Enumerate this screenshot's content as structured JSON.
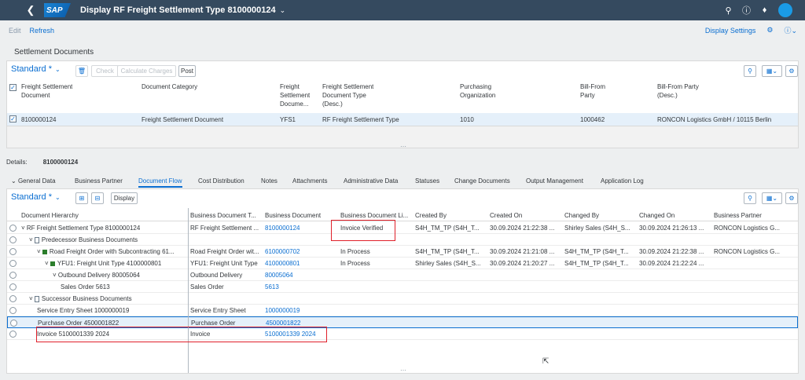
{
  "shell": {
    "title": "Display RF Freight Settlement Type 8100000124",
    "logo": "SAP"
  },
  "toolbar": {
    "edit": "Edit",
    "refresh": "Refresh",
    "display_settings": "Display Settings"
  },
  "section_title": "Settlement Documents",
  "settlement": {
    "view": "Standard *",
    "buttons": {
      "check": "Check",
      "calc": "Calculate Charges",
      "post": "Post"
    },
    "columns": [
      [
        "Freight Settlement",
        "Document"
      ],
      [
        "Document Category"
      ],
      [
        "Freight",
        "Settlement",
        "Docume..."
      ],
      [
        "Freight Settlement",
        "Document Type",
        "(Desc.)"
      ],
      [
        "Purchasing",
        "Organization"
      ],
      [
        "Bill-From",
        "Party"
      ],
      [
        "Bill-From Party",
        "(Desc.)"
      ]
    ],
    "row": [
      "8100000124",
      "Freight Settlement Document",
      "YFS1",
      "RF Freight Settlement Type",
      "1010",
      "1000462",
      "RONCON Logistics GmbH / 10115 Berlin"
    ]
  },
  "details": {
    "label": "Details:",
    "value": "8100000124"
  },
  "tabs": [
    "General Data",
    "Business Partner",
    "Document Flow",
    "Cost Distribution",
    "Notes",
    "Attachments",
    "Administrative Data",
    "Statuses",
    "Change Documents",
    "Output Management",
    "Application Log"
  ],
  "flow": {
    "view": "Standard *",
    "display_btn": "Display",
    "columns": [
      "Document Hierarchy",
      "Business Document T...",
      "Business Document",
      "Business Document Li...",
      "Created By",
      "Created On",
      "Changed By",
      "Changed On",
      "Business Partner"
    ],
    "rows": [
      {
        "h": "RF Freight Settlement Type 8100000124",
        "t": "RF Freight Settlement ...",
        "d": "8100000124",
        "l": "Invoice Verified",
        "cb": "S4H_TM_TP (S4H_T...",
        "co": "30.09.2024 21:22:38 ...",
        "chb": "Shirley Sales (S4H_S...",
        "cho": "30.09.2024 21:26:13 ...",
        "bp": "RONCON Logistics G..."
      },
      {
        "h": "Predecessor Business Documents",
        "t": "",
        "d": "",
        "l": "",
        "cb": "",
        "co": "",
        "chb": "",
        "cho": "",
        "bp": ""
      },
      {
        "h": "Road Freight Order with Subcontracting 61...",
        "t": "Road Freight Order wit...",
        "d": "6100000702",
        "l": "In Process",
        "cb": "S4H_TM_TP (S4H_T...",
        "co": "30.09.2024 21:21:08 ...",
        "chb": "S4H_TM_TP (S4H_T...",
        "cho": "30.09.2024 21:22:38 ...",
        "bp": "RONCON Logistics G..."
      },
      {
        "h": "YFU1: Freight Unit Type 4100000801",
        "t": "YFU1: Freight Unit Type",
        "d": "4100000801",
        "l": "In Process",
        "cb": "Shirley Sales (S4H_S...",
        "co": "30.09.2024 21:20:27 ...",
        "chb": "S4H_TM_TP (S4H_T...",
        "cho": "30.09.2024 21:22:24 ...",
        "bp": ""
      },
      {
        "h": "Outbound Delivery 80005064",
        "t": "Outbound Delivery",
        "d": "80005064",
        "l": "",
        "cb": "",
        "co": "",
        "chb": "",
        "cho": "",
        "bp": ""
      },
      {
        "h": "Sales Order 5613",
        "t": "Sales Order",
        "d": "5613",
        "l": "",
        "cb": "",
        "co": "",
        "chb": "",
        "cho": "",
        "bp": ""
      },
      {
        "h": "Successor Business Documents",
        "t": "",
        "d": "",
        "l": "",
        "cb": "",
        "co": "",
        "chb": "",
        "cho": "",
        "bp": ""
      },
      {
        "h": "Service Entry Sheet 1000000019",
        "t": "Service Entry Sheet",
        "d": "1000000019",
        "l": "",
        "cb": "",
        "co": "",
        "chb": "",
        "cho": "",
        "bp": ""
      },
      {
        "h": "Purchase Order 4500001822",
        "t": "Purchase Order",
        "d": "4500001822",
        "l": "",
        "cb": "",
        "co": "",
        "chb": "",
        "cho": "",
        "bp": ""
      },
      {
        "h": "Invoice 5100001339 2024",
        "t": "Invoice",
        "d": "5100001339 2024",
        "l": "",
        "cb": "",
        "co": "",
        "chb": "",
        "cho": "",
        "bp": ""
      }
    ]
  },
  "colors": {
    "shell": "#354a5f",
    "link": "#0a6ed1",
    "highlight": "#e0202a"
  }
}
